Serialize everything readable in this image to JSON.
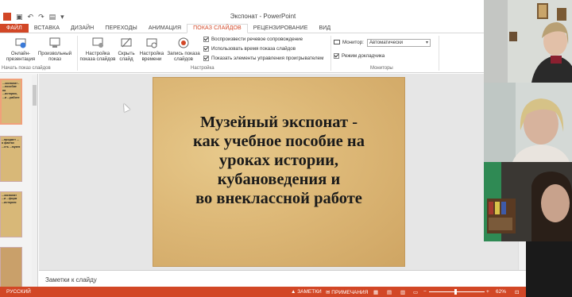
{
  "window": {
    "title": "Экспонат - PowerPoint"
  },
  "tabs": [
    "ФАЙЛ",
    "ВСТАВКА",
    "ДИЗАЙН",
    "ПЕРЕХОДЫ",
    "АНИМАЦИЯ",
    "ПОКАЗ СЛАЙДОВ",
    "РЕЦЕНЗИРОВАНИЕ",
    "ВИД"
  ],
  "active_tab": "ПОКАЗ СЛАЙДОВ",
  "ribbon": {
    "btn_online": "Онлайн-\nпрезентация",
    "btn_custom": "Произвольный\nпоказ",
    "btn_setup": "Настройка\nпоказа слайдов",
    "btn_hide": "Скрыть\nслайд",
    "btn_rehearse": "Настройка\nвремени",
    "btn_record": "Запись показа\nслайдов",
    "group_start": "Начать показ слайдов",
    "group_setup": "Настройка",
    "group_monitors": "Мониторы",
    "chk_narration": "Воспроизвести речевое сопровождение",
    "chk_timings": "Использовать время показа слайдов",
    "chk_controls": "Показать элементы управления проигрывателем",
    "monitor_label": "Монитор:",
    "monitor_value": "Автоматически",
    "presenter_view": "Режим докладчика"
  },
  "thumbnails": [
    {
      "text": "...экспонат - ...пособие на ...истории, ...и ...работе",
      "selected": true
    },
    {
      "text": "...предмет ... о фактах ...сть ...музея",
      "selected": false
    },
    {
      "text": "...экспонат ...и ...форм ...историю",
      "selected": false
    },
    {
      "text": "",
      "selected": false
    }
  ],
  "slide": {
    "title": "Музейный экспонат -\nкак учебное пособие на\nуроках истории,\nкубановедения и\nво внеклассной работе"
  },
  "notes_placeholder": "Заметки к слайду",
  "status": {
    "language": "РУССКИЙ",
    "notes": "ЗАМЕТКИ",
    "comments": "ПРИМЕЧАНИЯ",
    "zoom": "62%"
  },
  "colors": {
    "accent": "#d24726",
    "slide_bg": "#ddb877"
  }
}
